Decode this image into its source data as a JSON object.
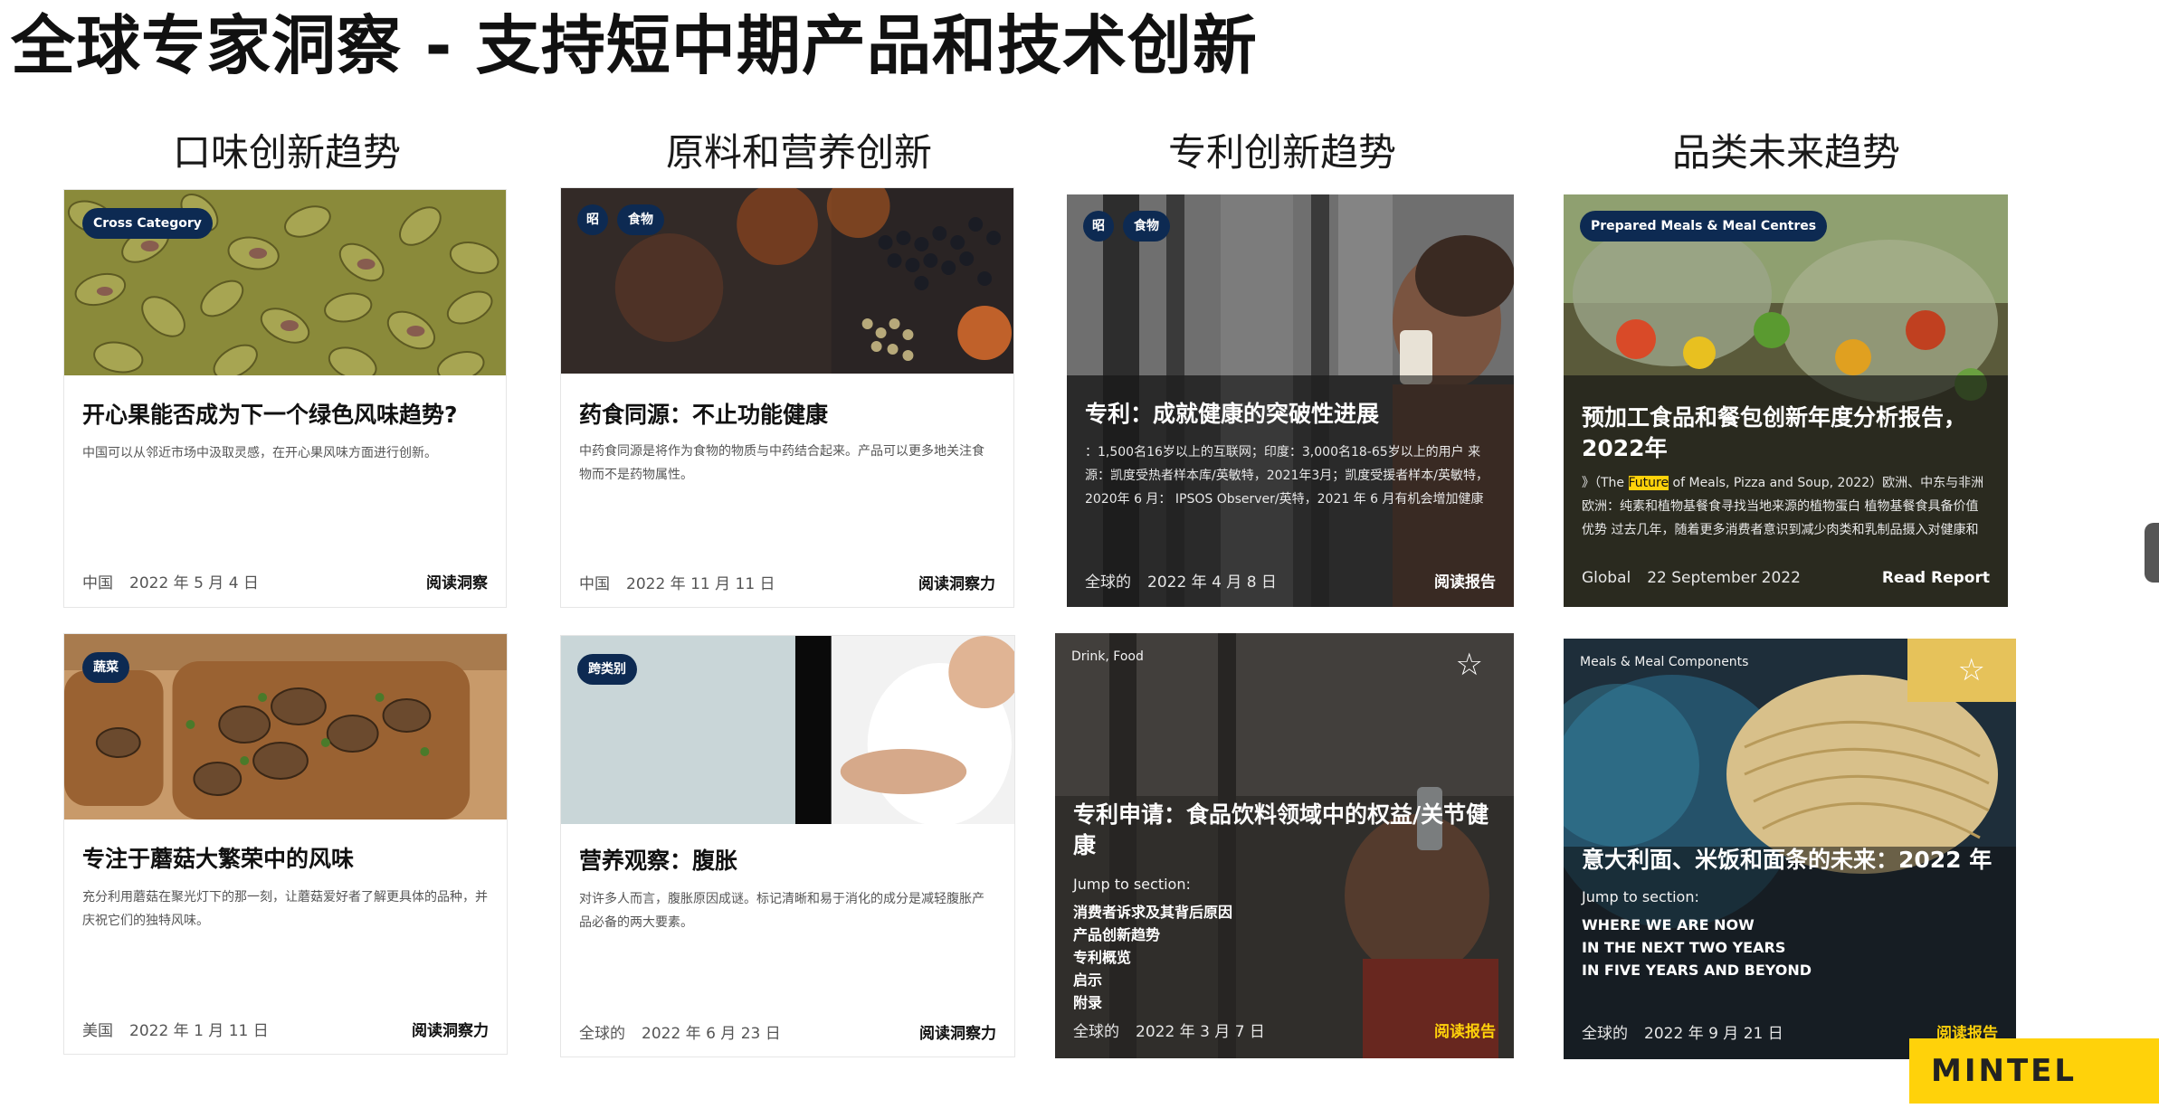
{
  "page": {
    "title": "全球专家洞察 - 支持短中期产品和技术创新",
    "columns": [
      "口味创新趋势",
      "原料和营养创新",
      "专利创新趋势",
      "品类未来趋势"
    ],
    "brand": "MINTEL"
  },
  "cards": {
    "pistachio": {
      "tag": "Cross Category",
      "title": "开心果能否成为下一个绿色风味趋势?",
      "desc": "中国可以从邻近市场中汲取灵感，在开心果风味方面进行创新。",
      "region": "中国",
      "date": "2022 年 5 月 4 日",
      "link": "阅读洞察"
    },
    "medicine_food": {
      "tags": [
        "昭",
        "食物"
      ],
      "title": "药食同源：不止功能健康",
      "desc": "中药食同源是将作为食物的物质与中药结合起来。产品可以更多地关注食物而不是药物属性。",
      "region": "中国",
      "date": "2022 年 11 月 11 日",
      "link": "阅读洞察力"
    },
    "patent_health": {
      "tags": [
        "昭",
        "食物"
      ],
      "title": "专利：成就健康的突破性进展",
      "desc": "：1,500名16岁以上的互联网；印度：3,000名18-65岁以上的用户 来源：凯度受热者样本库/英敏特，2021年3月；凯度受援者样本/英敏特，2020年 6 月： IPSOS Observer/英特，2021 年 6 月有机会增加健康与保健品",
      "region": "全球的",
      "date": "2022 年 4 月 8 日",
      "link": "阅读报告"
    },
    "prepared_meals": {
      "tag": "Prepared Meals & Meal Centres",
      "title": "预加工食品和餐包创新年度分析报告，2022年",
      "desc_prefix": "》（The ",
      "desc_highlight": "Future",
      "desc_rest": " of Meals, Pizza and Soup, 2022）欧洲、中东与非洲 欧洲：纯素和植物基餐食寻找当地来源的植物蛋白 植物基餐食具备价值优势 过去几年，随着更多消费者意识到减少肉类和乳制品摄入对健康和环境的好",
      "region": "Global",
      "date": "22 September 2022",
      "link": "Read Report"
    },
    "mushroom": {
      "tag": "蔬菜",
      "title": "专注于蘑菇大繁荣中的风味",
      "desc": "充分利用蘑菇在聚光灯下的那一刻，让蘑菇爱好者了解更具体的品种，并庆祝它们的独特风味。",
      "region": "美国",
      "date": "2022 年 1 月 11 日",
      "link": "阅读洞察力"
    },
    "bloating": {
      "tag": "跨类别",
      "title": "营养观察：腹胀",
      "desc": "对许多人而言，腹胀原因成谜。标记清晰和易于消化的成分是减轻腹胀产品必备的两大要素。",
      "region": "全球的",
      "date": "2022 年 6 月 23 日",
      "link": "阅读洞察力"
    },
    "patent_claims": {
      "category": "Drink, Food",
      "title": "专利申请：食品饮料领域中的权益/关节健康",
      "jump_label": "Jump to section:",
      "sections": [
        "消费者诉求及其背后原因",
        "产品创新趋势",
        "专利概览",
        "启示",
        "附录"
      ],
      "region": "全球的",
      "date": "2022 年 3 月 7 日",
      "link": "阅读报告"
    },
    "noodles": {
      "category": "Meals & Meal Components",
      "title": "意大利面、米饭和面条的未来：2022 年",
      "jump_label": "Jump to section:",
      "sections": [
        "WHERE WE ARE NOW",
        "IN THE NEXT TWO YEARS",
        "IN FIVE YEARS AND BEYOND"
      ],
      "region": "全球的",
      "date": "2022 年 9 月 21 日",
      "link": "阅读报告"
    }
  },
  "icons": {
    "star": "star-outline-icon"
  },
  "colors": {
    "tag_bg": "#0d2a52",
    "accent_yellow": "#ffd20a"
  }
}
